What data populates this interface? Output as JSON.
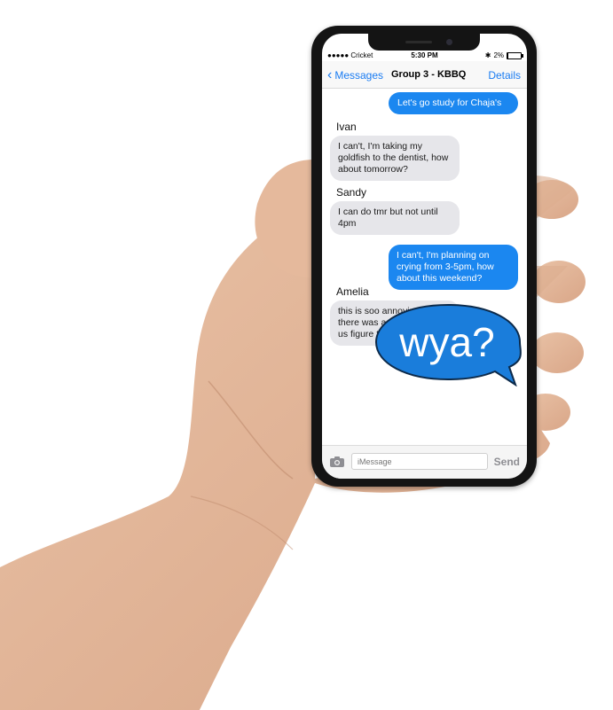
{
  "status_bar": {
    "carrier": "Cricket",
    "time": "5:30 PM",
    "battery": "2%",
    "battery_level": 0.02
  },
  "navbar": {
    "back_label": "Messages",
    "title": "Group 3 - KBBQ",
    "details_label": "Details"
  },
  "messages": [
    {
      "direction": "outgoing",
      "text": "Let's go study for Chaja's"
    },
    {
      "direction": "incoming",
      "sender": "Ivan",
      "text": "I can't, I'm taking my goldfish to the dentist, how about tomorrow?"
    },
    {
      "direction": "incoming",
      "sender": "Sandy",
      "text": "I can do tmr but not until 4pm"
    },
    {
      "direction": "outgoing",
      "text": "I can't, I'm planning on crying from 3-5pm, how about this weekend?"
    },
    {
      "direction": "incoming",
      "sender": "Amelia",
      "text": "this is soo annoying, I wish there was a website to help us figure this out"
    },
    {
      "direction": "outgoing",
      "text": "wya?"
    }
  ],
  "input_bar": {
    "placeholder": "iMessage",
    "send_label": "Send",
    "camera_icon": "camera-icon"
  },
  "colors": {
    "accent": "#1a7cf2",
    "outgoing_bubble": "#1b87f0",
    "incoming_bubble": "#e6e6ea",
    "big_bubble": "#1a7ddb"
  }
}
